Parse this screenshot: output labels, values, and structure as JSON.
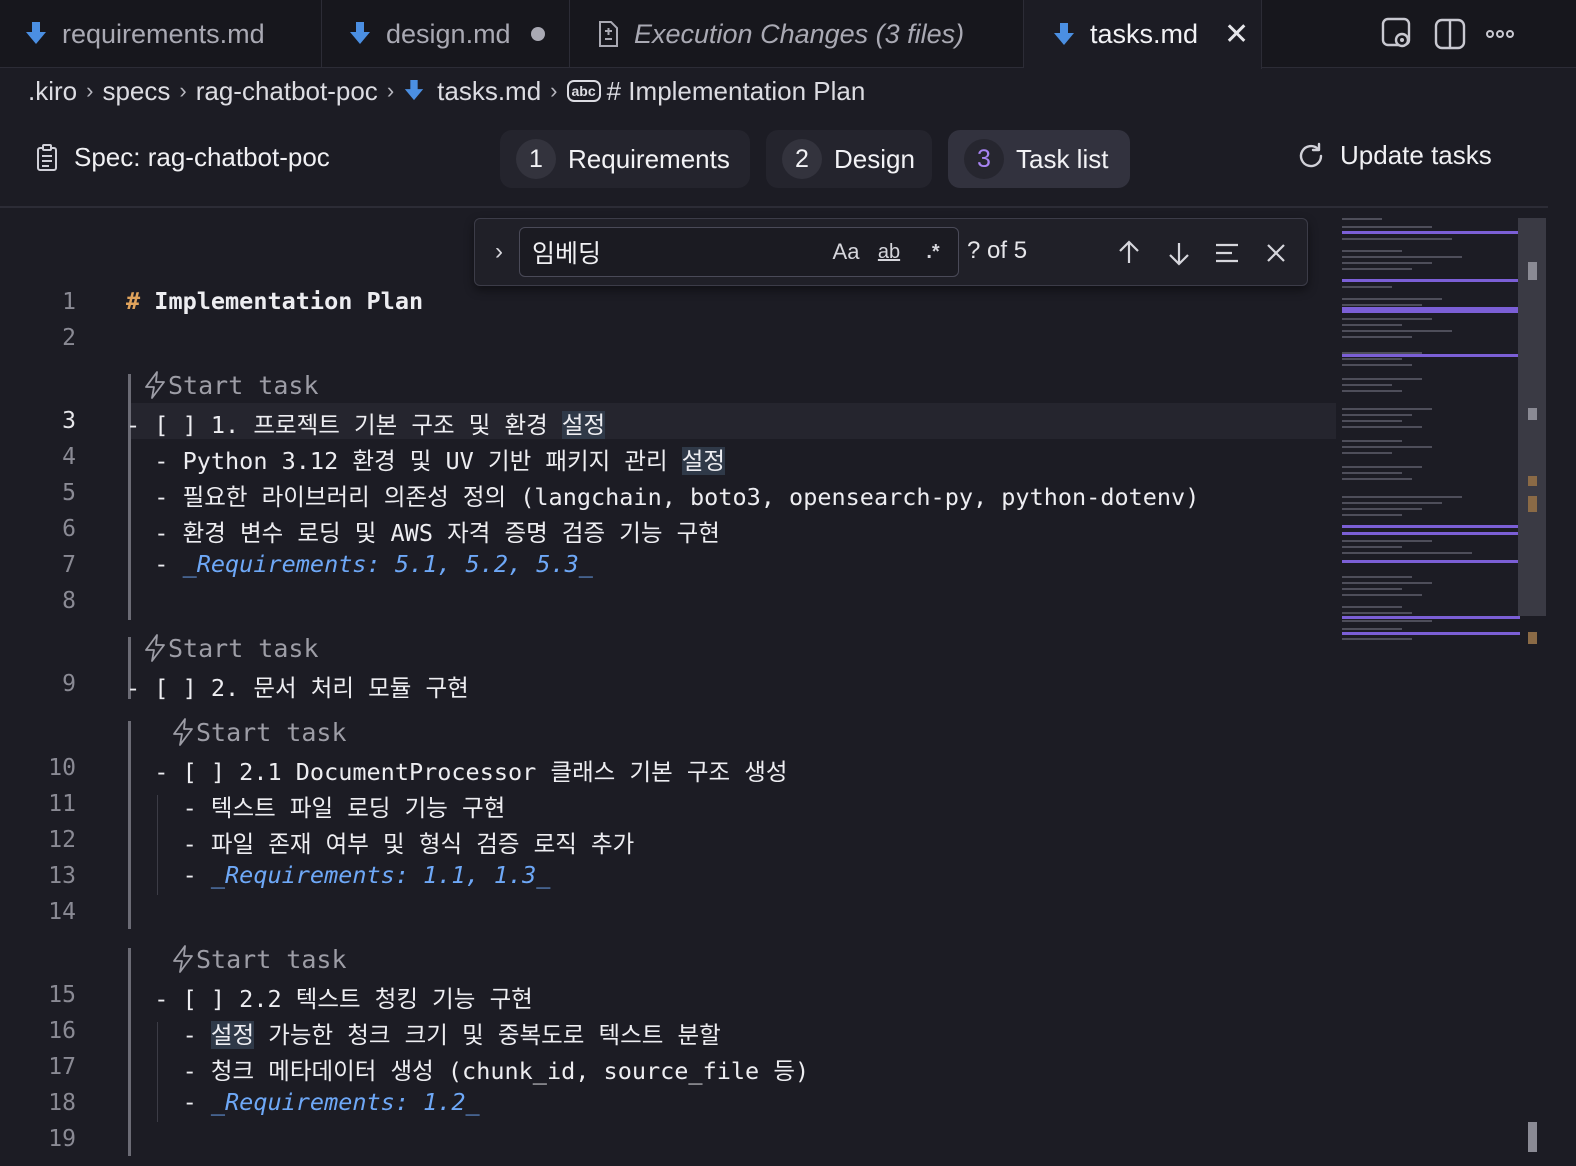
{
  "tabs": [
    {
      "label": "requirements.md",
      "icon": "markdown-file-icon"
    },
    {
      "label": "design.md",
      "icon": "markdown-file-icon",
      "modified": true
    },
    {
      "label": "Execution Changes (3 files)",
      "icon": "diff-file-icon"
    },
    {
      "label": "tasks.md",
      "icon": "markdown-file-icon",
      "active": true
    }
  ],
  "breadcrumb": {
    "items": [
      ".kiro",
      "specs",
      "rag-chatbot-poc",
      "tasks.md",
      "# Implementation Plan"
    ],
    "symbol_badge": "abc"
  },
  "spec": {
    "title": "Spec: rag-chatbot-poc",
    "steps": [
      {
        "num": "1",
        "label": "Requirements"
      },
      {
        "num": "2",
        "label": "Design"
      },
      {
        "num": "3",
        "label": "Task list",
        "active": true
      }
    ],
    "update_label": "Update tasks"
  },
  "find": {
    "query": "임베딩",
    "match_count": "? of 5",
    "options": [
      "Aa",
      "ab",
      ".*"
    ]
  },
  "editor": {
    "codelens_label": "Start task",
    "line_numbers": [
      "1",
      "2",
      "3",
      "4",
      "5",
      "6",
      "7",
      "8",
      "9",
      "10",
      "11",
      "12",
      "13",
      "14",
      "15",
      "16",
      "17",
      "18",
      "19"
    ],
    "lines": {
      "l1": {
        "hash": "# ",
        "text": "Implementation Plan"
      },
      "l3": {
        "pre": "- [ ] 1. 프로젝트 기본 구조 및 환경 ",
        "hl": "설정"
      },
      "l4": {
        "pre": "  - Python 3.12 환경 및 UV 기반 패키지 관리 ",
        "hl": "설정"
      },
      "l5": "  - 필요한 라이브러리 의존성 정의 (langchain, boto3, opensearch-py, python-dotenv)",
      "l6": "  - 환경 변수 로딩 및 AWS 자격 증명 검증 기능 구현",
      "l7": {
        "pre": "  - ",
        "req": "_Requirements: 5.1, 5.2, 5.3_"
      },
      "l9": "- [ ] 2. 문서 처리 모듈 구현",
      "l10": "  - [ ] 2.1 DocumentProcessor 클래스 기본 구조 생성",
      "l11": "    - 텍스트 파일 로딩 기능 구현",
      "l12": "    - 파일 존재 여부 및 형식 검증 로직 추가",
      "l13": {
        "pre": "    - ",
        "req": "_Requirements: 1.1, 1.3_"
      },
      "l15": "  - [ ] 2.2 텍스트 청킹 기능 구현",
      "l16": {
        "pre": "    - ",
        "hl": "설정",
        "post": " 가능한 청크 크기 및 중복도로 텍스트 분할"
      },
      "l17": "    - 청크 메타데이터 생성 (chunk_id, source_file 등)",
      "l18": {
        "pre": "    - ",
        "req": "_Requirements: 1.2_"
      }
    }
  },
  "colors": {
    "accent": "#a884f3",
    "requirements_link": "#6ea8f7",
    "heading_hash": "#e0a35c",
    "minimap_match": "#7b5fd6"
  }
}
